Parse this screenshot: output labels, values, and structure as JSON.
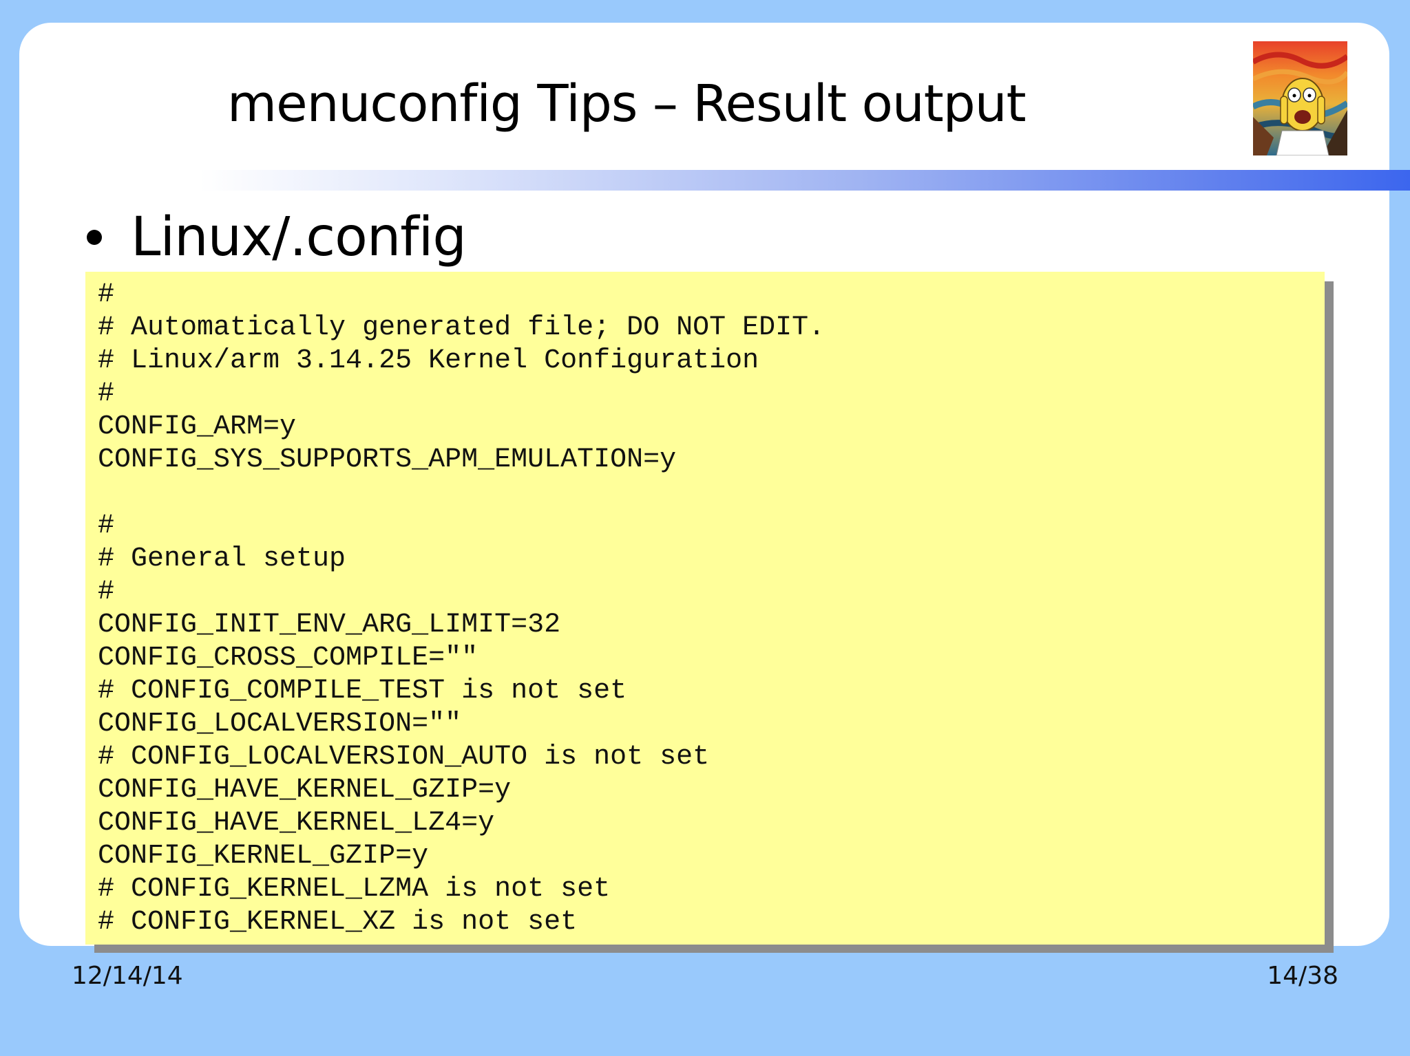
{
  "slide": {
    "title": "menuconfig Tips – Result output",
    "bullet": "Linux/.config",
    "logo_icon": "scream-painting-cartoon-icon",
    "code_lines": [
      "#",
      "# Automatically generated file; DO NOT EDIT.",
      "# Linux/arm 3.14.25 Kernel Configuration",
      "#",
      "CONFIG_ARM=y",
      "CONFIG_SYS_SUPPORTS_APM_EMULATION=y",
      "",
      "#",
      "# General setup",
      "#",
      "CONFIG_INIT_ENV_ARG_LIMIT=32",
      "CONFIG_CROSS_COMPILE=\"\"",
      "# CONFIG_COMPILE_TEST is not set",
      "CONFIG_LOCALVERSION=\"\"",
      "# CONFIG_LOCALVERSION_AUTO is not set",
      "CONFIG_HAVE_KERNEL_GZIP=y",
      "CONFIG_HAVE_KERNEL_LZ4=y",
      "CONFIG_KERNEL_GZIP=y",
      "# CONFIG_KERNEL_LZMA is not set",
      "# CONFIG_KERNEL_XZ is not set"
    ]
  },
  "footer": {
    "date": "12/14/14",
    "page": "14/38"
  },
  "colors": {
    "background": "#99c9fc",
    "panel": "#ffffff",
    "code_background": "#ffff9a",
    "code_shadow": "#8c8c8c",
    "rule_end": "#3c66ee"
  }
}
